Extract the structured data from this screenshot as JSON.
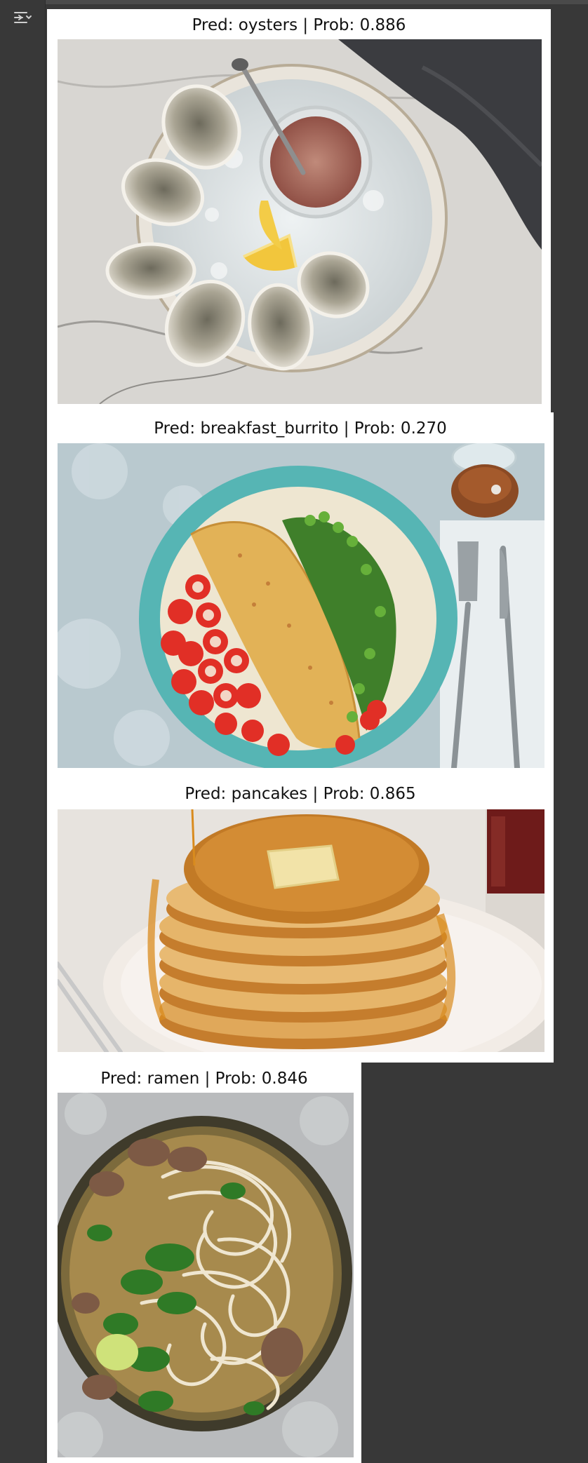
{
  "toolbar": {
    "collapse_icon": "collapse-output-icon"
  },
  "figures": [
    {
      "title": "Pred: oysters | Prob: 0.886",
      "image_subject": "oysters"
    },
    {
      "title": "Pred: breakfast_burrito | Prob: 0.270",
      "image_subject": "omelette"
    },
    {
      "title": "Pred: pancakes | Prob: 0.865",
      "image_subject": "pancakes"
    },
    {
      "title": "Pred: ramen | Prob: 0.846",
      "image_subject": "noodle soup"
    }
  ]
}
